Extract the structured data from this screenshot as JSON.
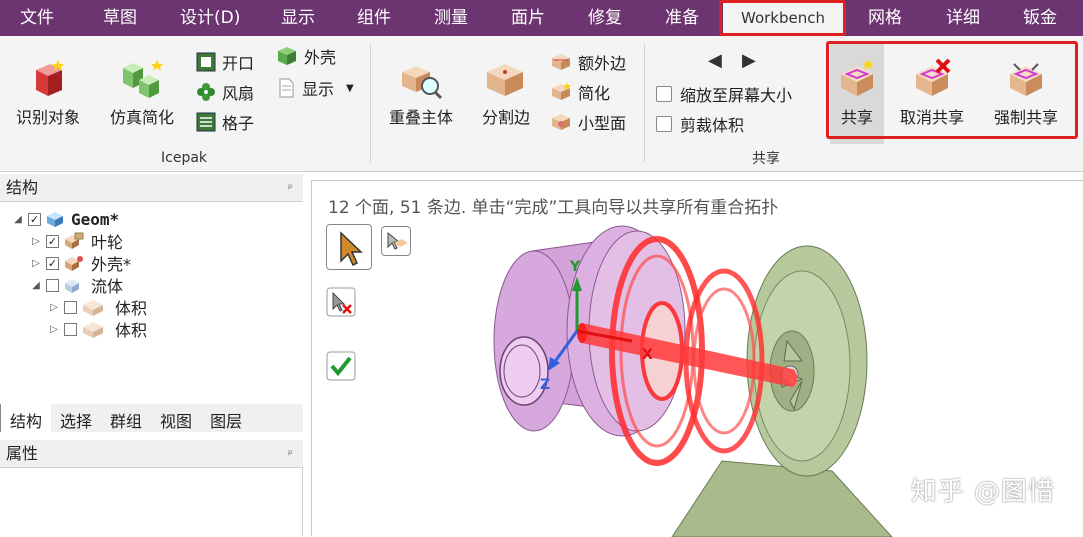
{
  "menubar": {
    "items": [
      "文件",
      "草图",
      "设计(D)",
      "显示",
      "组件",
      "测量",
      "面片",
      "修复",
      "准备",
      "Workbench",
      "网格",
      "详细",
      "钣金"
    ],
    "active": "Workbench"
  },
  "ribbon": {
    "icepak": {
      "label": "Icepak",
      "identify": "识别对象",
      "simplify": "仿真简化",
      "opening": "开口",
      "fan": "风扇",
      "grille": "格子",
      "enclosure": "外壳",
      "display": "显示"
    },
    "share_group": {
      "label": "共享",
      "overlap_body": "重叠主体",
      "split_edge": "分割边",
      "extra_edge": "额外边",
      "simplify": "简化",
      "small_face": "小型面",
      "zoom_fit": "缩放至屏幕大小",
      "crop_volume": "剪裁体积",
      "share": "共享",
      "unshare": "取消共享",
      "force_share": "强制共享"
    }
  },
  "structure": {
    "title": "结构",
    "root": "Geom*",
    "children": [
      "叶轮",
      "外壳*",
      "流体"
    ],
    "fluid_children": [
      "体积",
      "体积"
    ]
  },
  "tabs": [
    "结构",
    "选择",
    "群组",
    "视图",
    "图层"
  ],
  "properties": {
    "title": "属性"
  },
  "viewport": {
    "status": "12 个面, 51 条边. 单击“完成”工具向导以共享所有重合拓扑",
    "axis_y": "Y",
    "axis_x": "X",
    "axis_z": "Z"
  },
  "watermark": "知乎 @图惜",
  "colors": {
    "menubar": "#6c3470",
    "highlight_red": "#e02020",
    "housing_purple": "#d7a8dd",
    "housing_green": "#b5c79a"
  }
}
